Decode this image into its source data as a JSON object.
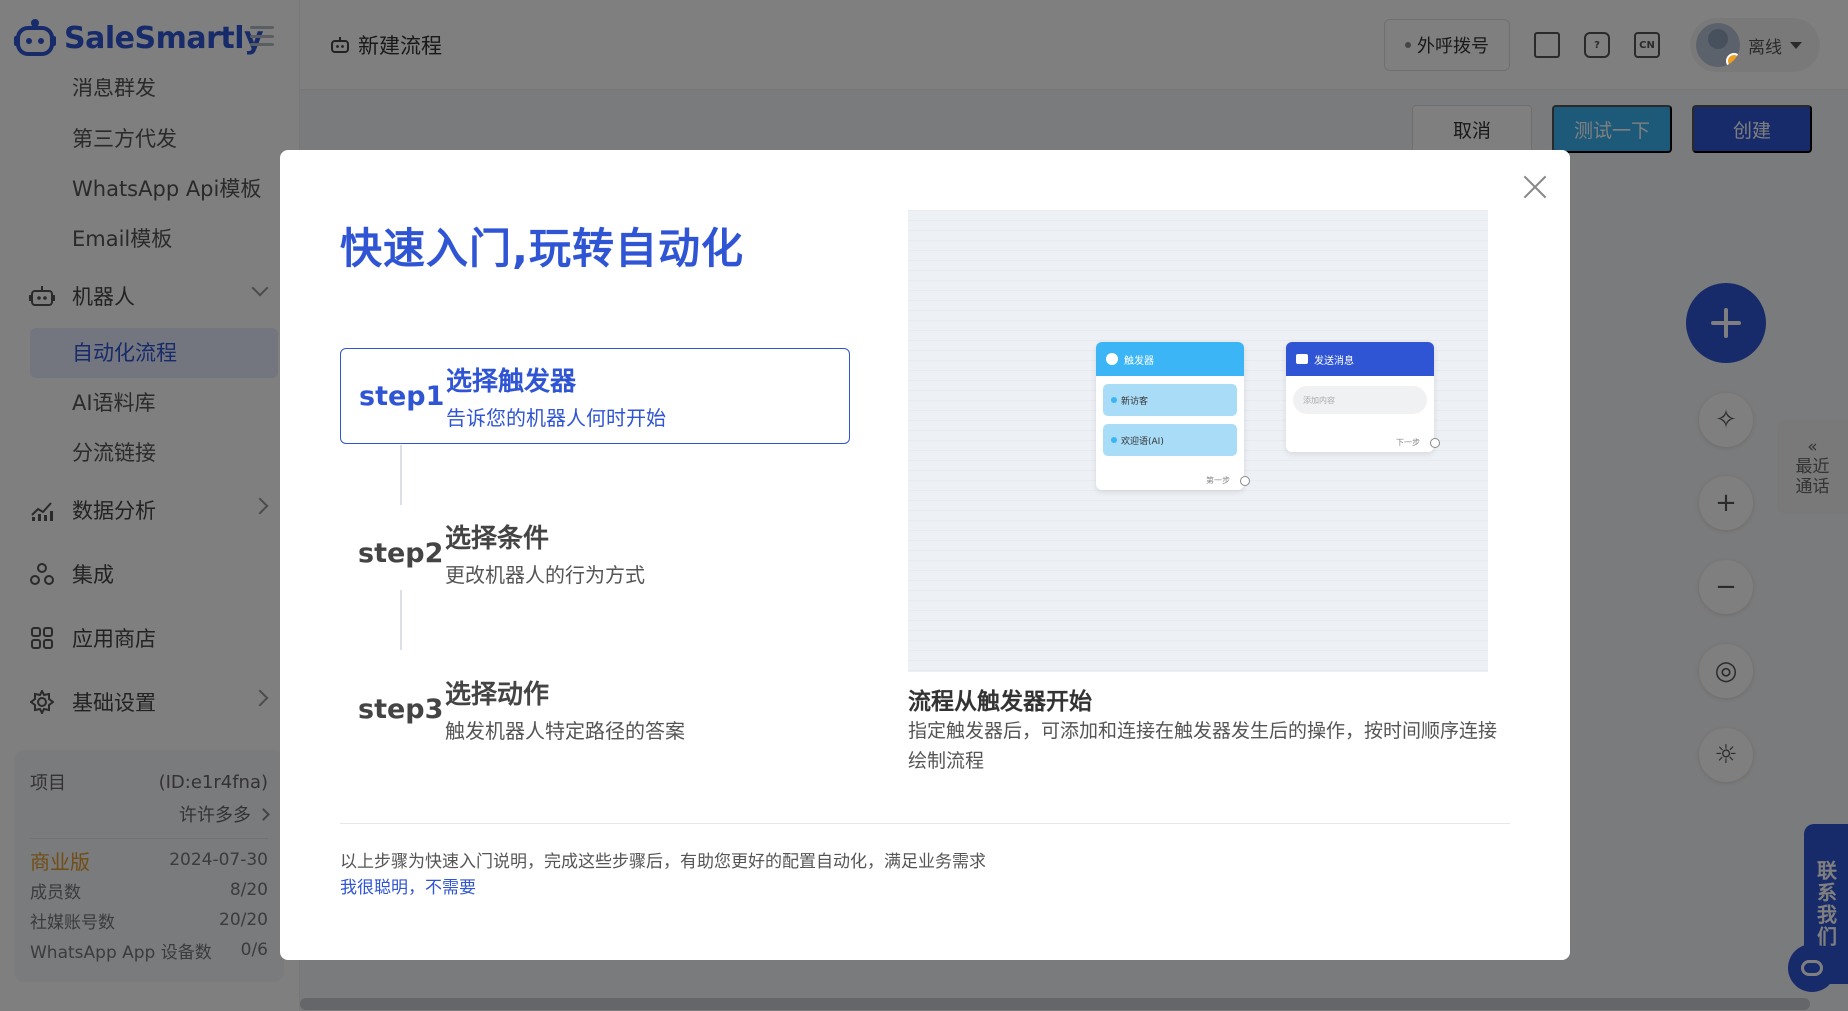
{
  "brand": {
    "name": "SaleSmartly"
  },
  "sidebar": {
    "sub_items_top": [
      "消息群发",
      "第三方代发",
      "WhatsApp Api模板",
      "Email模板"
    ],
    "robot_group": "机器人",
    "robot_items": [
      "自动化流程",
      "AI语料库",
      "分流链接"
    ],
    "groups": [
      "数据分析",
      "集成",
      "应用商店",
      "基础设置"
    ]
  },
  "project": {
    "label": "项目",
    "id": "(ID:e1r4fna)",
    "name": "许许多多",
    "edition": "商业版",
    "expire": "2024-07-30",
    "members_label": "成员数",
    "members_value": "8/20",
    "social_label": "社媒账号数",
    "social_value": "20/20",
    "wa_label": "WhatsApp App 设备数",
    "wa_value": "0/6"
  },
  "topbar": {
    "title": "新建流程",
    "dial_button": "外呼拨号",
    "lang_badge": "CN",
    "user_status": "离线"
  },
  "actions": {
    "cancel": "取消",
    "test": "测试一下",
    "create": "创建"
  },
  "side_tabs": {
    "recent_line1": "最近",
    "recent_line2": "通话",
    "contact": "联系我们"
  },
  "modal": {
    "title": "快速入门,玩转自动化",
    "steps": [
      {
        "no": "step1",
        "title": "选择触发器",
        "desc": "告诉您的机器人何时开始"
      },
      {
        "no": "step2",
        "title": "选择条件",
        "desc": "更改机器人的行为方式"
      },
      {
        "no": "step3",
        "title": "选择动作",
        "desc": "触发机器人特定路径的答案"
      }
    ],
    "preview": {
      "trigger_node_title": "触发器",
      "trigger_rows": [
        "新访客",
        "欢迎语(AI)"
      ],
      "trigger_foot": "第一步",
      "message_node_title": "发送消息",
      "message_placeholder": "添加内容",
      "message_foot": "下一步"
    },
    "preview_title": "流程从触发器开始",
    "preview_desc": "指定触发器后，可添加和连接在触发器发生后的操作，按时间顺序连接绘制流程",
    "note": "以上步骤为快速入门说明，完成这些步骤后，有助您更好的配置自动化，满足业务需求",
    "skip_link": "我很聪明，不需要"
  },
  "colors": {
    "primary": "#2f55d4",
    "sky": "#3bb5f5",
    "edition": "#e49b2b"
  }
}
